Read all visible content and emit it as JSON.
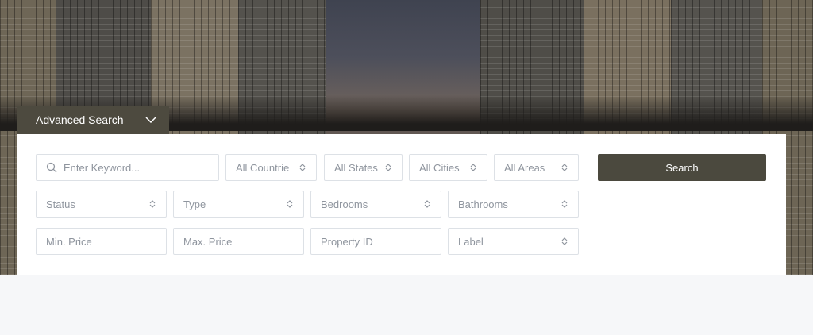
{
  "advanced_search": {
    "tab_label": "Advanced Search",
    "keyword_placeholder": "Enter Keyword...",
    "row1": [
      "All Countrie",
      "All States",
      "All Cities",
      "All Areas"
    ],
    "row2": [
      "Status",
      "Type",
      "Bedrooms",
      "Bathrooms"
    ],
    "row3": {
      "min_price": "Min. Price",
      "max_price": "Max. Price",
      "property_id": "Property ID",
      "label": "Label"
    },
    "search_button": "Search"
  },
  "colors": {
    "accent": "#4b493e",
    "border": "#dde1e6",
    "placeholder": "#8f959e",
    "page_bg": "#f6f7f9"
  },
  "icons": {
    "search": "search-icon",
    "chevron": "chevron-down-icon",
    "sort": "sort-arrows-icon"
  }
}
